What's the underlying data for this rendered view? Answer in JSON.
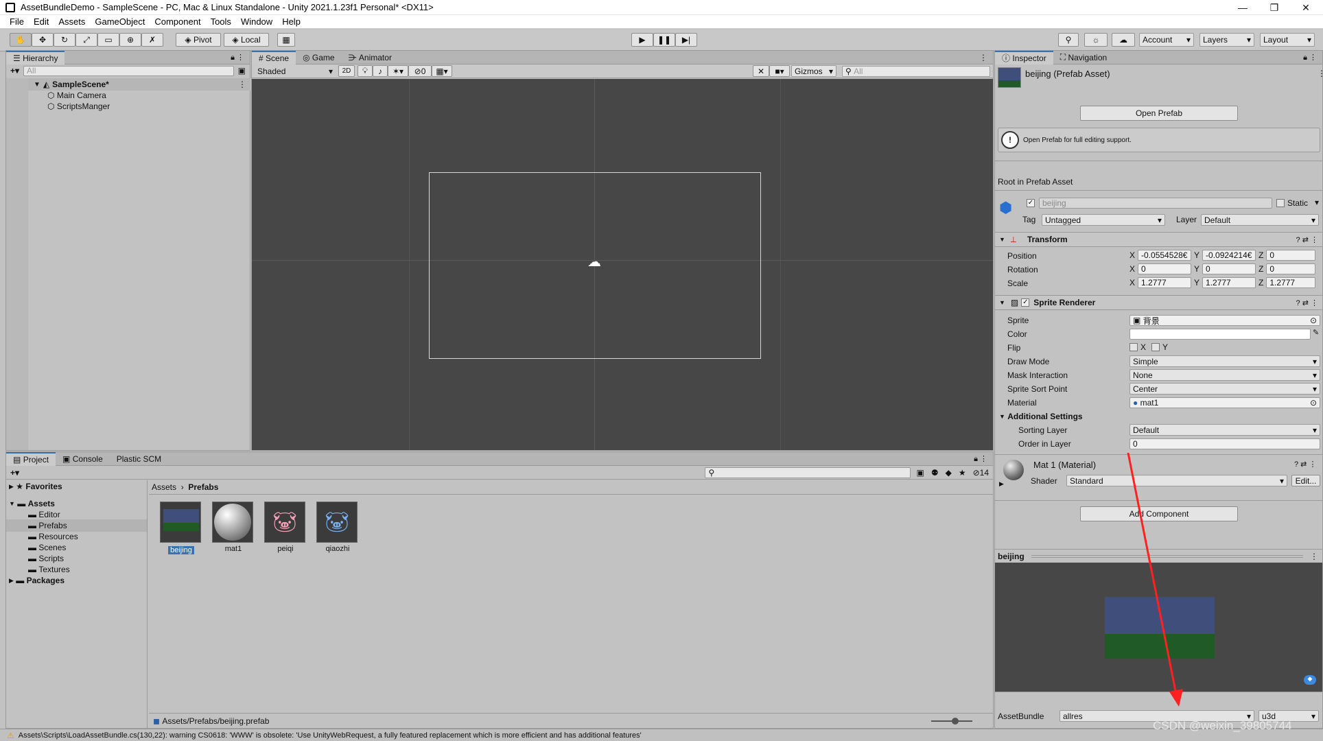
{
  "window": {
    "title": "AssetBundleDemo - SampleScene - PC, Mac & Linux Standalone - Unity 2021.1.23f1 Personal* <DX11>",
    "min": "—",
    "max": "❐",
    "close": "✕"
  },
  "menu": [
    "File",
    "Edit",
    "Assets",
    "GameObject",
    "Component",
    "Tools",
    "Window",
    "Help"
  ],
  "toolbar": {
    "pivot": "Pivot",
    "local": "Local",
    "account": "Account",
    "layers": "Layers",
    "layout": "Layout"
  },
  "hierarchy": {
    "tab": "Hierarchy",
    "search_placeholder": "All",
    "scene": "SampleScene*",
    "items": [
      "Main Camera",
      "ScriptsManger"
    ]
  },
  "scene": {
    "tabs": [
      "Scene",
      "Game",
      "Animator"
    ],
    "shading": "Shaded",
    "mode2d": "2D",
    "hidden_count": "0",
    "gizmos": "Gizmos",
    "search_placeholder": "All"
  },
  "project": {
    "tabs": [
      "Project",
      "Console",
      "Plastic SCM"
    ],
    "hidden_count": "14",
    "favorites": "Favorites",
    "assets": "Assets",
    "folders": [
      "Editor",
      "Prefabs",
      "Resources",
      "Scenes",
      "Scripts",
      "Textures"
    ],
    "packages": "Packages",
    "breadcrumb": [
      "Assets",
      "Prefabs"
    ],
    "items": [
      "beijing",
      "mat1",
      "peiqi",
      "qiaozhi"
    ],
    "path": "Assets/Prefabs/beijing.prefab"
  },
  "inspector": {
    "tabs": [
      "Inspector",
      "Navigation"
    ],
    "title": "beijing (Prefab Asset)",
    "open_prefab": "Open Prefab",
    "help": "Open Prefab for full editing support.",
    "root_label": "Root in Prefab Asset",
    "name": "beijing",
    "static": "Static",
    "tag_label": "Tag",
    "tag": "Untagged",
    "layer_label": "Layer",
    "layer": "Default",
    "transform": {
      "header": "Transform",
      "position_label": "Position",
      "rotation_label": "Rotation",
      "scale_label": "Scale",
      "position": [
        "-0.0554528€",
        "-0.0924214€",
        "0"
      ],
      "rotation": [
        "0",
        "0",
        "0"
      ],
      "scale": [
        "1.2777",
        "1.2777",
        "1.2777"
      ]
    },
    "sprite_renderer": {
      "header": "Sprite Renderer",
      "sprite_label": "Sprite",
      "sprite": "背景",
      "color_label": "Color",
      "flip_label": "Flip",
      "flip_x": "X",
      "flip_y": "Y",
      "draw_mode_label": "Draw Mode",
      "draw_mode": "Simple",
      "mask_label": "Mask Interaction",
      "mask": "None",
      "sort_point_label": "Sprite Sort Point",
      "sort_point": "Center",
      "material_label": "Material",
      "material": "mat1",
      "additional": "Additional Settings",
      "sorting_layer_label": "Sorting Layer",
      "sorting_layer": "Default",
      "order_label": "Order in Layer",
      "order": "0"
    },
    "material": {
      "title": "Mat 1 (Material)",
      "shader_label": "Shader",
      "shader": "Standard",
      "edit": "Edit..."
    },
    "add_component": "Add Component",
    "preview_title": "beijing",
    "assetbundle_label": "AssetBundle",
    "assetbundle": "allres",
    "variant": "u3d"
  },
  "status": {
    "message": "Assets\\Scripts\\LoadAssetBundle.cs(130,22): warning CS0618: 'WWW' is obsolete: 'Use UnityWebRequest, a fully featured replacement which is more efficient and has additional features'",
    "watermark": "CSDN @weixin_39805744"
  },
  "colors": {
    "accent": "#3a72b0",
    "scene_bg": "#474747",
    "arrow": "#ff2020"
  }
}
